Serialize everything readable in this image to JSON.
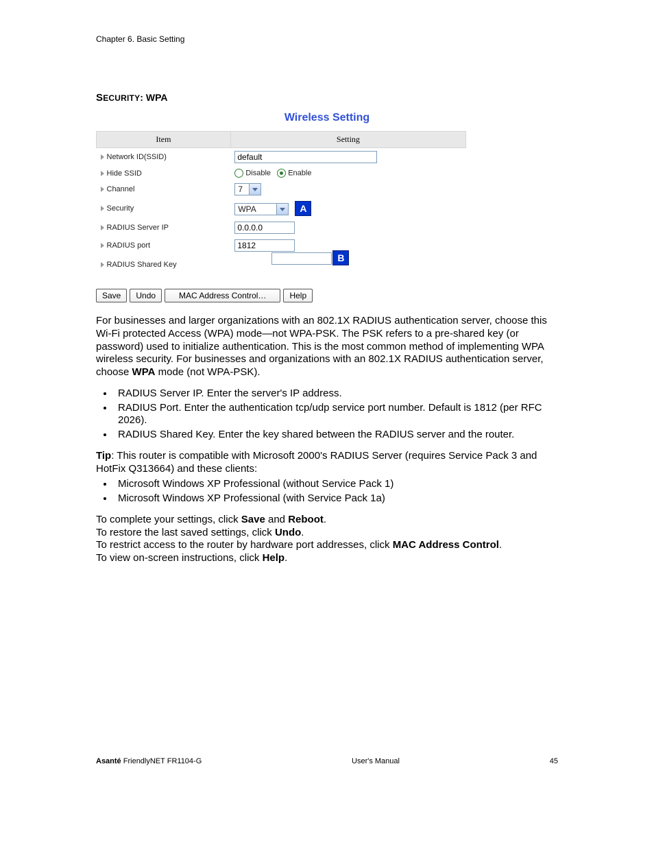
{
  "header": {
    "chapter": "Chapter 6. Basic Setting"
  },
  "section": {
    "prefix_caps": "Security",
    "colon": ": ",
    "suffix_bold": "WPA"
  },
  "ws": {
    "title": "Wireless Setting",
    "col_item": "Item",
    "col_setting": "Setting",
    "rows": {
      "ssid": {
        "label": "Network ID(SSID)",
        "value": "default"
      },
      "hide": {
        "label": "Hide SSID",
        "opt_disable": "Disable",
        "opt_enable": "Enable"
      },
      "channel": {
        "label": "Channel",
        "value": "7"
      },
      "security": {
        "label": "Security",
        "value": "WPA"
      },
      "radius_ip": {
        "label": "RADIUS Server IP",
        "value": "0.0.0.0"
      },
      "radius_port": {
        "label": "RADIUS port",
        "value": "1812"
      },
      "radius_key": {
        "label": "RADIUS Shared Key",
        "value": ""
      }
    },
    "callout_a": "A",
    "callout_b": "B",
    "buttons": {
      "save": "Save",
      "undo": "Undo",
      "mac": "MAC Address Control…",
      "help": "Help"
    }
  },
  "para1": "For businesses and larger organizations with an 802.1X RADIUS authentication server, choose this Wi-Fi protected Access (WPA) mode—not WPA-PSK. The PSK refers to a pre-shared key (or password) used to initialize authentication. This is the most common method of implementing WPA wireless security. For businesses and organizations with an 802.1X RADIUS authentication server, choose ",
  "para1_bold": "WPA",
  "para1_tail": " mode (not WPA-PSK).",
  "list1": {
    "i1": "RADIUS Server IP. Enter the server's IP address.",
    "i2": "RADIUS Port. Enter the authentication tcp/udp service port number. Default is 1812 (per RFC 2026).",
    "i3": "RADIUS Shared Key. Enter the key shared between the RADIUS server and the router."
  },
  "tip_label": "Tip",
  "tip_text": ": This router is compatible with Microsoft 2000's RADIUS Server (requires Service Pack 3 and HotFix Q313664) and these clients:",
  "list2": {
    "i1": "Microsoft Windows XP Professional (without Service Pack 1)",
    "i2": "Microsoft Windows XP Professional (with Service Pack 1a)"
  },
  "actions": {
    "l1a": "To complete your settings, click ",
    "l1b1": "Save",
    "l1m": " and ",
    "l1b2": "Reboot",
    "l1t": ".",
    "l2a": "To restore the last saved settings, click ",
    "l2b": "Undo",
    "l2t": ".",
    "l3a": "To restrict access to the router by hardware port addresses, click ",
    "l3b": "MAC Address Control",
    "l3t": ".",
    "l4a": "To view on-screen instructions, click ",
    "l4b": "Help",
    "l4t": "."
  },
  "footer": {
    "brand_bold": "Asanté",
    "brand_rest": " FriendlyNET FR1104-G",
    "center": "User's Manual",
    "page": "45"
  }
}
